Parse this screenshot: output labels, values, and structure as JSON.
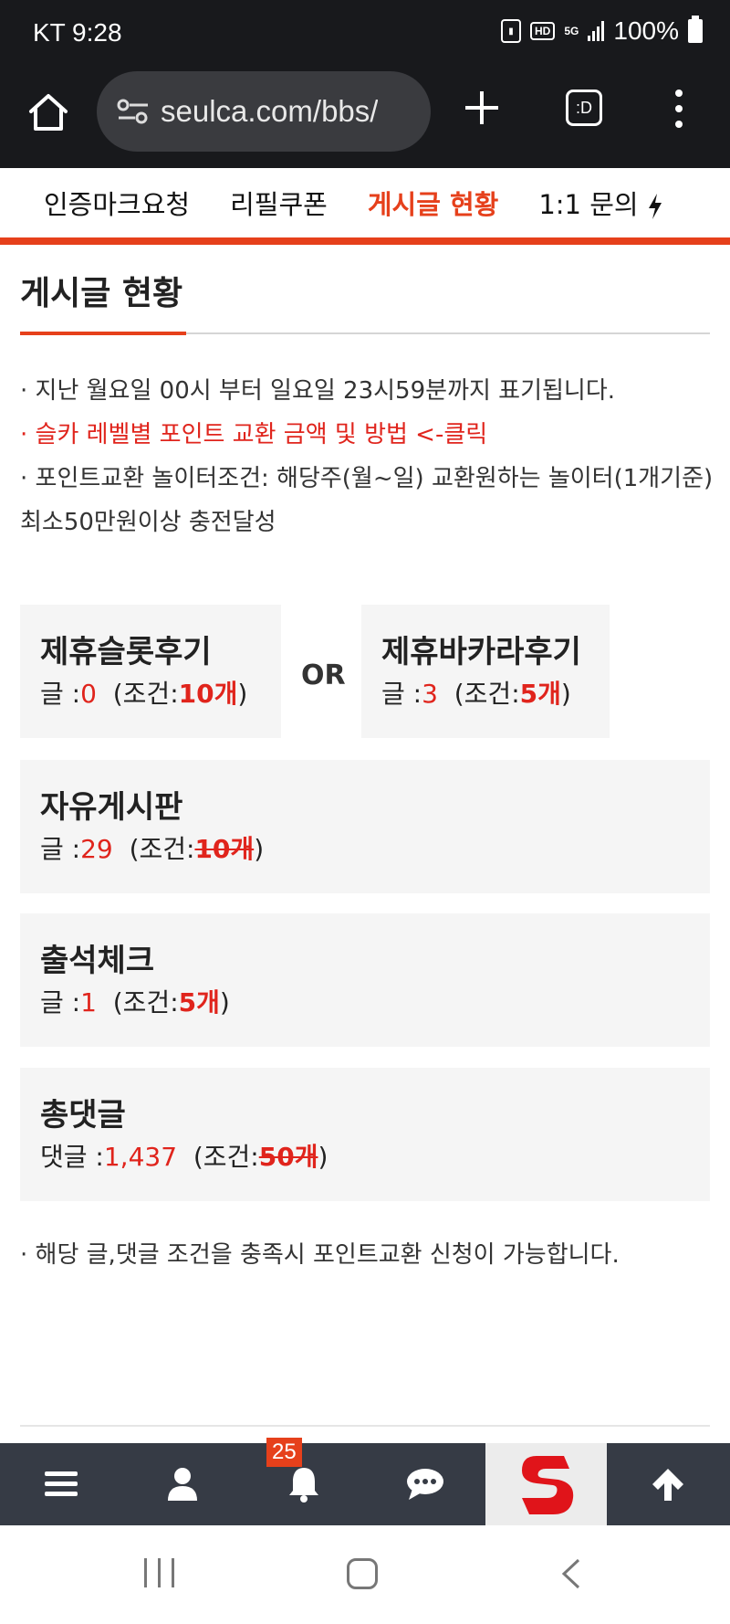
{
  "status_bar": {
    "carrier_time": "KT 9:28",
    "network": "5G",
    "battery": "100%"
  },
  "browser": {
    "url": "seulca.com/bbs/",
    "tabs_label": ":D"
  },
  "sub_nav": {
    "items": [
      "인증마크요청",
      "리필쿠폰",
      "게시글 현황",
      "1:1 문의"
    ],
    "active_index": 2
  },
  "page": {
    "title": "게시글 현황",
    "notices": [
      "· 지난 월요일 00시 부터 일요일 23시59분까지 표기됩니다.",
      "· 슬카 레벨별 포인트 교환 금액 및 방법 <-클릭",
      "· 포인트교환 놀이터조건: 해당주(월~일) 교환원하는 놀이터(1개기준) 최소50만원이상 충전달성"
    ],
    "boxes": {
      "slot": {
        "title": "제휴슬롯후기",
        "prefix": "글 :",
        "count": "0",
        "cond_prefix": "(조건:",
        "cond_value": "10개",
        "cond_suffix": ")"
      },
      "or_label": "OR",
      "baccarat": {
        "title": "제휴바카라후기",
        "prefix": "글 :",
        "count": "3",
        "cond_prefix": "(조건:",
        "cond_value": "5개",
        "cond_suffix": ")"
      },
      "free": {
        "title": "자유게시판",
        "prefix": "글 :",
        "count": "29",
        "cond_prefix": "(조건:",
        "cond_value": "10개",
        "cond_suffix": ")"
      },
      "attendance": {
        "title": "출석체크",
        "prefix": "글 :",
        "count": "1",
        "cond_prefix": "(조건:",
        "cond_value": "5개",
        "cond_suffix": ")"
      },
      "comments": {
        "title": "총댓글",
        "prefix": "댓글 :",
        "count": "1,437",
        "cond_prefix": "(조건:",
        "cond_value": "50개",
        "cond_suffix": ")"
      }
    },
    "footer_note": "· 해당 글,댓글 조건을 충족시 포인트교환 신청이 가능합니다."
  },
  "app_bar": {
    "notification_count": "25",
    "buttons": [
      "menu-icon",
      "user-icon",
      "bell-icon",
      "chat-icon",
      "logo",
      "arrow-up-icon"
    ]
  },
  "colors": {
    "accent": "#e6401b",
    "count_red": "#e0241c",
    "dark_bar": "#363b45",
    "browser_bg": "#18191c"
  }
}
